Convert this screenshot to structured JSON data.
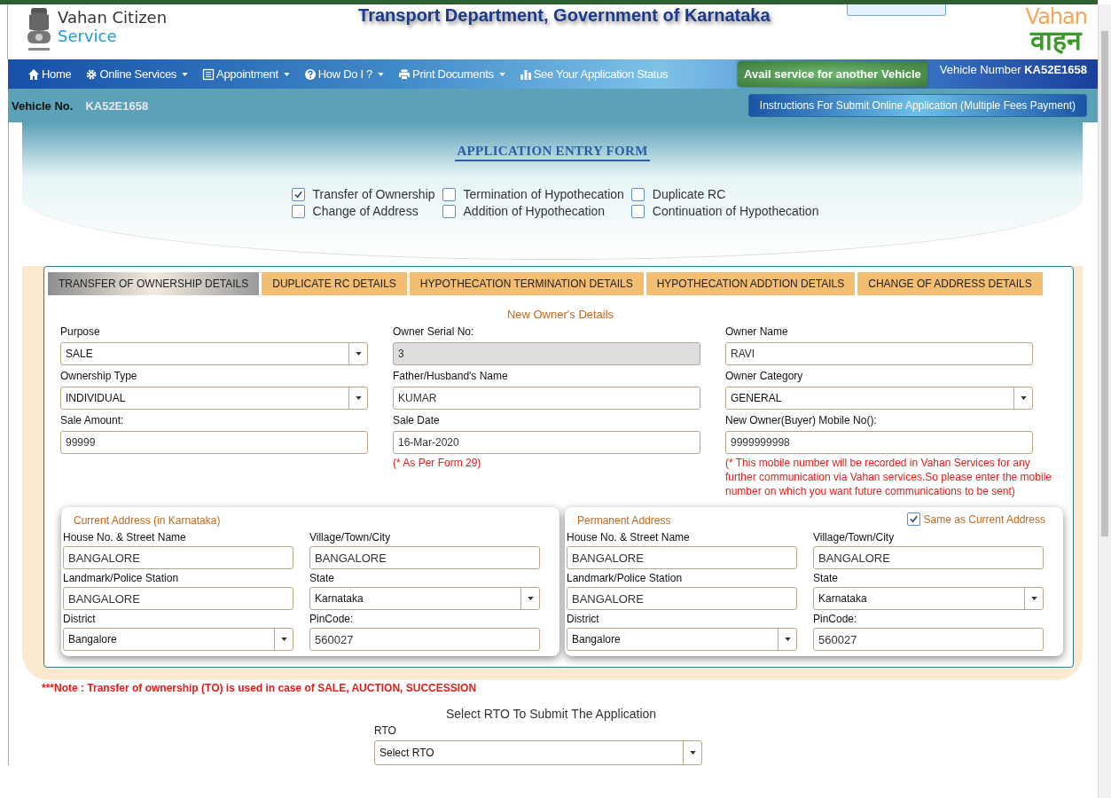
{
  "header": {
    "brand_line1": "Vahan Citizen",
    "brand_line2": "Service",
    "title": "Transport Department, Government of Karnataka",
    "logo_top": "Vahan",
    "logo_bottom": "वाहन"
  },
  "nav": {
    "items": [
      {
        "label": "Home",
        "dropdown": false
      },
      {
        "label": "Online Services",
        "dropdown": true
      },
      {
        "label": "Appointment",
        "dropdown": true
      },
      {
        "label": "How Do I ?",
        "dropdown": true
      },
      {
        "label": "Print Documents",
        "dropdown": true
      },
      {
        "label": "See Your Application Status",
        "dropdown": false
      }
    ],
    "another_vehicle_button": "Avail service for another Vehicle",
    "vehicle_number_label": "Vehicle Number",
    "vehicle_number": "KA52E1658"
  },
  "subbar": {
    "label": "Vehicle No.",
    "value": "KA52E1658",
    "instructions_button": "Instructions For Submit Online Application (Multiple Fees Payment)"
  },
  "form": {
    "title": "APPLICATION ENTRY FORM",
    "services": [
      {
        "label": "Transfer of Ownership",
        "checked": true
      },
      {
        "label": "Termination of Hypothecation",
        "checked": false
      },
      {
        "label": "Duplicate RC",
        "checked": false
      },
      {
        "label": "Change of Address",
        "checked": false
      },
      {
        "label": "Addition of Hypothecation",
        "checked": false
      },
      {
        "label": "Continuation of Hypothecation",
        "checked": false
      }
    ]
  },
  "tabs": [
    {
      "label": "TRANSFER OF OWNERSHIP DETAILS",
      "selected": true
    },
    {
      "label": "DUPLICATE RC DETAILS",
      "selected": false
    },
    {
      "label": "HYPOTHECATION TERMINATION DETAILS",
      "selected": false
    },
    {
      "label": "HYPOTHECATION ADDTION DETAILS",
      "selected": false
    },
    {
      "label": "CHANGE OF ADDRESS DETAILS",
      "selected": false
    }
  ],
  "owner_details": {
    "heading": "New Owner's Details",
    "fields": [
      {
        "label": "Purpose",
        "kind": "select",
        "value": "SALE"
      },
      {
        "label": "Owner Serial No:",
        "kind": "readonly",
        "value": "3"
      },
      {
        "label": "Owner Name",
        "kind": "text",
        "value": "RAVI"
      },
      {
        "label": "Ownership Type",
        "kind": "select",
        "value": "INDIVIDUAL"
      },
      {
        "label": "Father/Husband's Name",
        "kind": "text",
        "value": "KUMAR"
      },
      {
        "label": "Owner Category",
        "kind": "select",
        "value": "GENERAL"
      },
      {
        "label": "Sale Amount:",
        "kind": "text",
        "value": "99999"
      },
      {
        "label": "Sale Date",
        "kind": "text",
        "value": "16-Mar-2020",
        "note": "(* As Per Form 29)"
      },
      {
        "label": "New Owner(Buyer) Mobile No():",
        "kind": "text",
        "value": "9999999998",
        "note": "(* This mobile number will be recorded in Vahan Services for any further communication via Vahan services.So please enter the mobile number on which you want future communications to be sent)"
      }
    ]
  },
  "addresses": [
    {
      "title": "Current Address (in Karnataka)",
      "fields": [
        {
          "label": "House No. & Street Name",
          "kind": "text",
          "value": "BANGALORE"
        },
        {
          "label": "Village/Town/City",
          "kind": "text",
          "value": "BANGALORE"
        },
        {
          "label": "Landmark/Police Station",
          "kind": "text",
          "value": "BANGALORE"
        },
        {
          "label": "State",
          "kind": "select",
          "value": "Karnataka"
        },
        {
          "label": "District",
          "kind": "select",
          "value": "Bangalore"
        },
        {
          "label": "PinCode:",
          "kind": "text",
          "value": "560027"
        }
      ]
    },
    {
      "title": "Permanent Address",
      "same_as_label": "Same as Current Address",
      "same_as_checked": true,
      "fields": [
        {
          "label": "House No. & Street Name",
          "kind": "text",
          "value": "BANGALORE"
        },
        {
          "label": "Village/Town/City",
          "kind": "text",
          "value": "BANGALORE"
        },
        {
          "label": "Landmark/Police Station",
          "kind": "text",
          "value": "BANGALORE"
        },
        {
          "label": "State",
          "kind": "select",
          "value": "Karnataka"
        },
        {
          "label": "District",
          "kind": "select",
          "value": "Bangalore"
        },
        {
          "label": "PinCode:",
          "kind": "text",
          "value": "560027"
        }
      ]
    }
  ],
  "note": "***Note : Transfer of ownership (TO) is used in case of SALE, AUCTION, SUCCESSION",
  "rto": {
    "heading": "Select RTO To Submit The Application",
    "label": "RTO",
    "value": "Select RTO"
  }
}
